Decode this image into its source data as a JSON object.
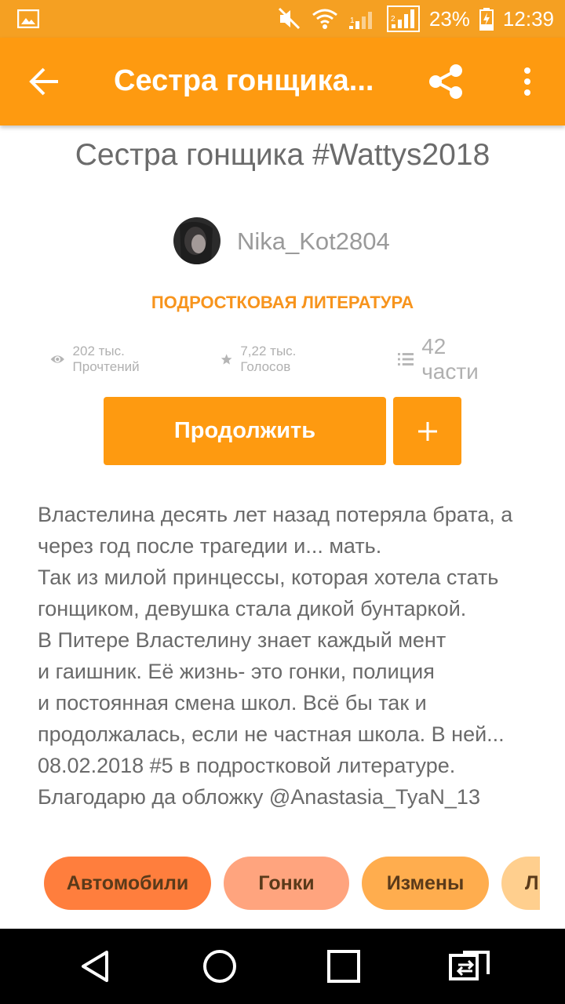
{
  "status_bar": {
    "battery_percent": "23%",
    "time": "12:39",
    "signal_labels": [
      "1",
      "2"
    ],
    "icons": [
      "image-icon",
      "mute-icon",
      "wifi-icon",
      "signal-1-icon",
      "signal-2-icon",
      "battery-charging-icon"
    ]
  },
  "app_bar": {
    "title": "Сестра гонщика...",
    "icons": [
      "back-arrow-icon",
      "share-icon",
      "more-vert-icon"
    ]
  },
  "story": {
    "title": "Сестра гонщика #Wattys2018",
    "author": "Nika_Kot2804",
    "category": "ПОДРОСТКОВАЯ ЛИТЕРАТУРА",
    "stats": {
      "reads": "202 тыс. Прочтений",
      "votes": "7,22 тыс. Голосов",
      "parts": "42 части"
    },
    "continue_label": "Продолжить",
    "add_label": "+",
    "description_lines": [
      "Властелина десять лет назад потеряла брата, а",
      "через год после трагедии и... мать.",
      "Так из милой принцессы, которая хотела стать",
      "гонщиком, девушка стала дикой бунтаркой.",
      "В Питере Властелину знает каждый мент",
      "и гаишник. Её жизнь- это гонки, полиция",
      "и постоянная смена школ. Всё бы так и",
      "продолжалась, если не частная школа. В ней...",
      "08.02.2018 #5 в подростковой литературе.",
      "Благодарю да обложку @Anastasia_TyaN_13"
    ],
    "tags": [
      "Автомобили",
      "Гонки",
      "Измены",
      "Л"
    ]
  },
  "colors": {
    "app_bar": "#fe9a10",
    "status_bar": "#f5a022",
    "accent": "#f7941d",
    "tag_colors": [
      "#ff7e3d",
      "#ffa47e",
      "#ffad4e",
      "#ffcf8e"
    ]
  },
  "nav_bar": {
    "icons": [
      "back-triangle-icon",
      "home-circle-icon",
      "recents-square-icon",
      "switch-app-icon"
    ]
  }
}
